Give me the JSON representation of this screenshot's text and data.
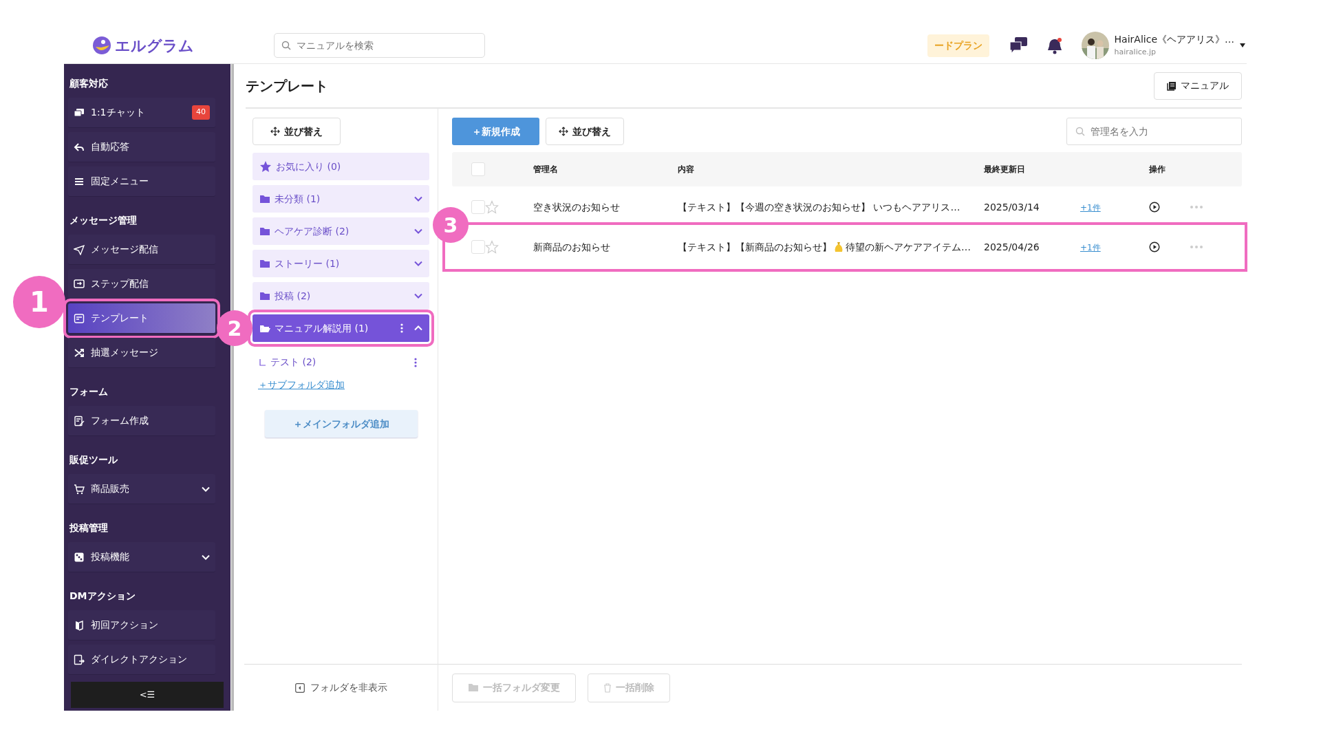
{
  "header": {
    "logo": "エルグラム",
    "search": {
      "placeholder": "マニュアルを検索"
    },
    "plan": "ードプラン",
    "notification_dot": true,
    "account": {
      "name": "HairAlice《ヘアアリス》…",
      "domain": "hairalice.jp"
    }
  },
  "sidebar": {
    "sections": [
      {
        "title": "顧客対応",
        "items": [
          {
            "label": "1:1チャット",
            "badge": "40",
            "selected": false,
            "highlighted": false
          },
          {
            "label": "自動応答",
            "selected": false,
            "highlighted": false
          },
          {
            "label": "固定メニュー",
            "selected": false,
            "highlighted": false
          }
        ]
      },
      {
        "title": "メッセージ管理",
        "items": [
          {
            "label": "メッセージ配信",
            "selected": false,
            "highlighted": false
          },
          {
            "label": "ステップ配信",
            "selected": false,
            "highlighted": false
          },
          {
            "label": "テンプレート",
            "selected": true,
            "highlighted": true
          },
          {
            "label": "抽選メッセージ",
            "selected": false,
            "highlighted": false
          }
        ]
      },
      {
        "title": "フォーム",
        "items": [
          {
            "label": "フォーム作成",
            "selected": false,
            "highlighted": false
          }
        ]
      },
      {
        "title": "販促ツール",
        "items": [
          {
            "label": "商品販売",
            "expanded": false,
            "selected": false,
            "highlighted": false
          }
        ]
      },
      {
        "title": "投稿管理",
        "items": [
          {
            "label": "投稿機能",
            "expanded": false,
            "selected": false,
            "highlighted": false
          }
        ]
      },
      {
        "title": "DMアクション",
        "items": [
          {
            "label": "初回アクション",
            "selected": false,
            "highlighted": false
          },
          {
            "label": "ダイレクトアクション",
            "selected": false,
            "highlighted": false
          }
        ]
      }
    ],
    "collapse": "<☰"
  },
  "page": {
    "title": "テンプレート",
    "manual_button": "マニュアル"
  },
  "folders": {
    "sort_button": "並び替え",
    "items": [
      {
        "kind": "favorite",
        "label": "お気に入り (0)",
        "selected": false,
        "highlighted": false
      },
      {
        "kind": "folder",
        "label": "未分類 (1)",
        "expanded": false,
        "selected": false,
        "highlighted": false
      },
      {
        "kind": "folder",
        "label": "ヘアケア診断 (2)",
        "expanded": false,
        "selected": false,
        "highlighted": false
      },
      {
        "kind": "folder",
        "label": "ストーリー (1)",
        "expanded": false,
        "selected": false,
        "highlighted": false
      },
      {
        "kind": "folder",
        "label": "投稿 (2)",
        "expanded": false,
        "selected": false,
        "highlighted": false
      },
      {
        "kind": "folder",
        "label": "マニュアル解説用 (1)",
        "expanded": true,
        "selected": true,
        "highlighted": true,
        "children": [
          {
            "label": "テスト (2)"
          }
        ]
      }
    ],
    "add_subfolder": "＋サブフォルダ追加",
    "add_main": "＋メインフォルダ追加",
    "hide": "フォルダを非表示"
  },
  "toolbar": {
    "new_button": "＋新規作成",
    "sort_button": "並び替え",
    "search": {
      "placeholder": "管理名を入力"
    }
  },
  "table": {
    "all_checked": false,
    "columns": [
      "管理名",
      "内容",
      "最終更新日",
      "操作"
    ],
    "rows": [
      {
        "checked": false,
        "favorite": false,
        "name": "空き状況のお知らせ",
        "content": [
          {
            "kind": "text",
            "text": "【テキスト】【今週の空き状況のお知らせ】 いつもヘアアリス…"
          }
        ],
        "date": "2025/03/14",
        "link": "+1件",
        "highlighted": false
      },
      {
        "checked": false,
        "favorite": false,
        "name": "新商品のお知らせ",
        "content": [
          {
            "kind": "text",
            "text": "【テキスト】【新商品のお知らせ】"
          },
          {
            "kind": "emoji"
          },
          {
            "kind": "text",
            "text": "待望の新ヘアケアアイテム…"
          }
        ],
        "date": "2025/04/26",
        "link": "+1件",
        "highlighted": true
      }
    ]
  },
  "bulk": [
    {
      "kind": "folder",
      "label": "一括フォルダ変更",
      "disabled": true
    },
    {
      "kind": "trash",
      "label": "一括削除",
      "disabled": true
    }
  ],
  "annotations": [
    {
      "label": "1"
    },
    {
      "label": "2"
    },
    {
      "label": "3"
    }
  ]
}
